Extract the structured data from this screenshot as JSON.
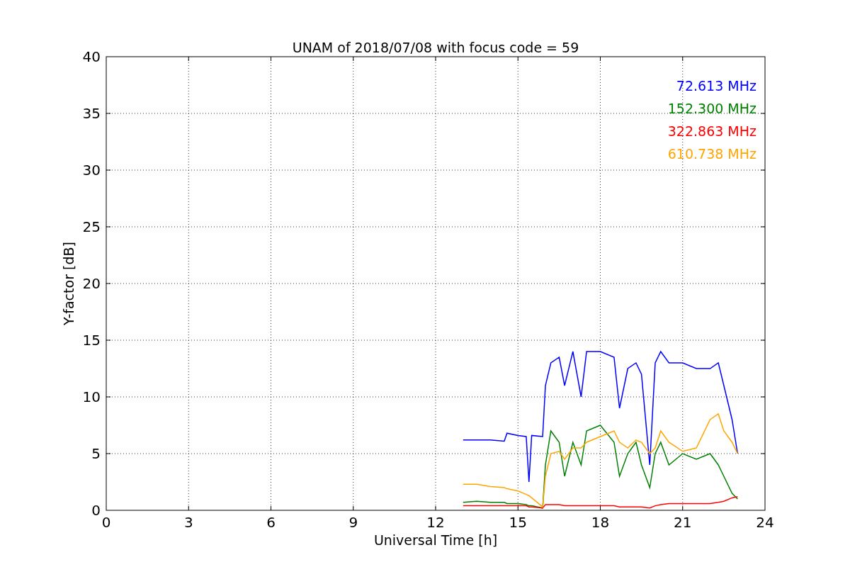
{
  "figure": {
    "chart_data": {
      "type": "line",
      "title": "UNAM of 2018/07/08 with focus code = 59",
      "xlabel": "Universal Time [h]",
      "ylabel": "Y-factor [dB]",
      "xlim": [
        0,
        24
      ],
      "ylim": [
        0,
        40
      ],
      "xticks": [
        0,
        3,
        6,
        9,
        12,
        15,
        18,
        21,
        24
      ],
      "yticks": [
        0,
        5,
        10,
        15,
        20,
        25,
        30,
        35,
        40
      ],
      "grid": true,
      "x": [
        13,
        13.5,
        14,
        14.5,
        14.6,
        15,
        15.3,
        15.4,
        15.5,
        15.9,
        16,
        16.2,
        16.5,
        16.7,
        17,
        17.3,
        17.5,
        18,
        18.5,
        18.7,
        19,
        19.3,
        19.5,
        19.8,
        20,
        20.2,
        20.5,
        21,
        21.5,
        22,
        22.3,
        22.5,
        22.8,
        23
      ],
      "series": [
        {
          "name": "72.613 MHz",
          "color": "#0000ff",
          "values": [
            6.2,
            6.2,
            6.2,
            6.1,
            6.8,
            6.6,
            6.5,
            2.5,
            6.6,
            6.5,
            11,
            13,
            13.5,
            11,
            14,
            10,
            14,
            14,
            13.5,
            9,
            12.5,
            13,
            12,
            4,
            13,
            14,
            13,
            13,
            12.5,
            12.5,
            13,
            11,
            8,
            5
          ]
        },
        {
          "name": "152.300 MHz",
          "color": "#008000",
          "values": [
            0.7,
            0.8,
            0.7,
            0.7,
            0.6,
            0.6,
            0.5,
            0.4,
            0.4,
            0.2,
            4,
            7,
            6,
            3,
            6,
            4,
            7,
            7.5,
            6,
            3,
            5,
            6,
            4,
            2,
            5,
            6,
            4,
            5,
            4.5,
            5,
            4,
            3,
            1.5,
            1
          ]
        },
        {
          "name": "322.863 MHz",
          "color": "#ff0000",
          "values": [
            0.4,
            0.4,
            0.4,
            0.4,
            0.4,
            0.4,
            0.4,
            0.3,
            0.3,
            0.2,
            0.5,
            0.5,
            0.5,
            0.4,
            0.4,
            0.4,
            0.4,
            0.4,
            0.4,
            0.3,
            0.3,
            0.3,
            0.3,
            0.2,
            0.4,
            0.5,
            0.6,
            0.6,
            0.6,
            0.6,
            0.7,
            0.8,
            1.1,
            1.2
          ]
        },
        {
          "name": "610.738 MHz",
          "color": "#ffa500",
          "values": [
            2.3,
            2.3,
            2.1,
            2,
            1.9,
            1.7,
            1.4,
            1.3,
            1.1,
            0.3,
            3,
            5,
            5.2,
            4.5,
            5.5,
            5.5,
            6,
            6.5,
            7,
            6,
            5.5,
            6.2,
            6,
            5,
            5.5,
            7,
            6,
            5.2,
            5.5,
            8,
            8.5,
            7,
            6,
            5
          ]
        }
      ]
    }
  }
}
